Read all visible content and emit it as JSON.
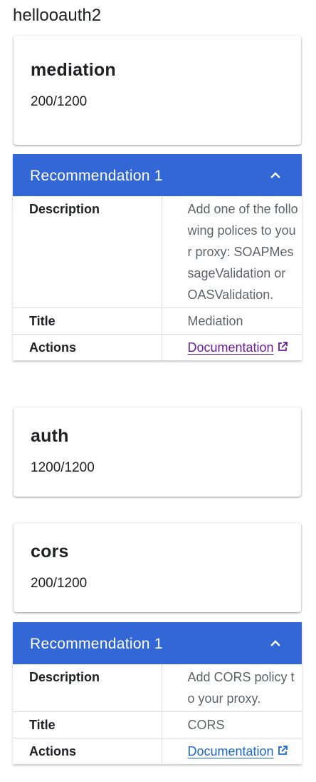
{
  "page": {
    "title": "hellooauth2"
  },
  "scores": [
    {
      "name": "mediation",
      "score": "200/1200"
    },
    {
      "name": "auth",
      "score": "1200/1200"
    },
    {
      "name": "cors",
      "score": "200/1200"
    }
  ],
  "recommendations": [
    {
      "header": "Recommendation 1",
      "rows": {
        "description_label": "Description",
        "description": "Add one of the following polices to your proxy: SOAPMessageValidation or OASValidation.",
        "title_label": "Title",
        "title": "Mediation",
        "actions_label": "Actions",
        "link_text": "Documentation"
      }
    },
    {
      "header": "Recommendation 1",
      "rows": {
        "description_label": "Description",
        "description": "Add CORS policy to your proxy.",
        "title_label": "Title",
        "title": "CORS",
        "actions_label": "Actions",
        "link_text": "Documentation"
      }
    }
  ],
  "icons": {
    "collapse": "chevron-up-icon",
    "external": "open-in-new-icon"
  },
  "colors": {
    "header_bg": "#3367d6",
    "link_visited": "#6a1b9a",
    "link": "#1967d2"
  }
}
